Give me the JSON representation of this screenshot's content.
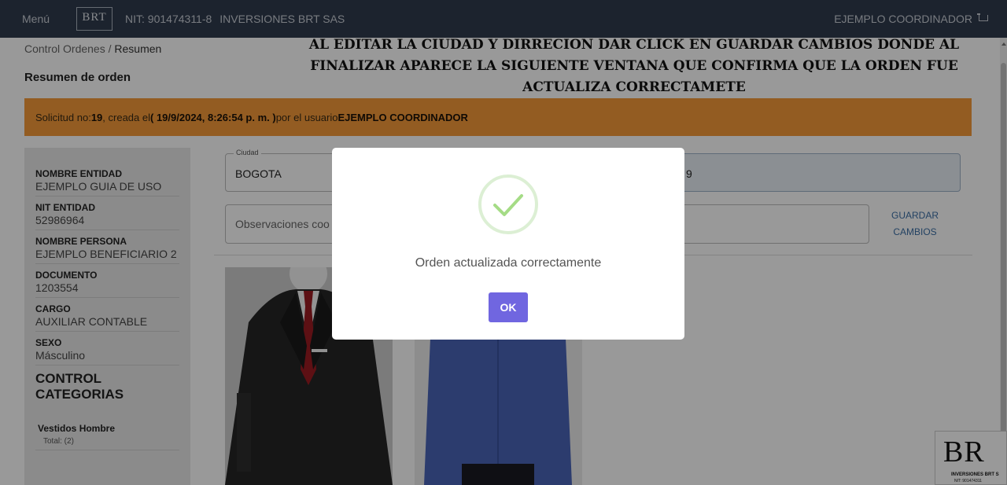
{
  "topbar": {
    "menu_label": "Menú",
    "logo_text": "BRT",
    "nit": "NIT: 901474311-8",
    "company": "INVERSIONES BRT SAS",
    "user": "EJEMPLO COORDINADOR"
  },
  "breadcrumb": {
    "parent": "Control Ordenes",
    "separator": "/",
    "current": "Resumen"
  },
  "page_title": "Resumen de orden",
  "annotation": "AL EDITAR LA CIUDAD Y DIRRECION DAR CLICK EN GUARDAR CAMBIOS DONDE AL FINALIZAR APARECE LA SIGUIENTE VENTANA QUE CONFIRMA QUE LA ORDEN FUE ACTUALIZA CORRECTAMETE",
  "banner": {
    "prefix": "Solicitud no: ",
    "number": "19",
    "mid": ", creada el ",
    "date": "( 19/9/2024, 8:26:54 p. m. )",
    "by": " por el usuario ",
    "user": "EJEMPLO COORDINADOR",
    "color": "#f59a3a"
  },
  "sidebar": {
    "fields": [
      {
        "label": "NOMBRE ENTIDAD",
        "value": "EJEMPLO GUIA DE USO"
      },
      {
        "label": "NIT ENTIDAD",
        "value": "52986964"
      },
      {
        "label": "NOMBRE PERSONA",
        "value": "EJEMPLO BENEFICIARIO 2"
      },
      {
        "label": "DOCUMENTO",
        "value": "1203554"
      },
      {
        "label": "CARGO",
        "value": "AUXILIAR CONTABLE"
      },
      {
        "label": "SEXO",
        "value": "Másculino"
      }
    ],
    "categories_title": "CONTROL CATEGORIAS",
    "categories": [
      {
        "name": "Vestidos Hombre",
        "total": "Total: (2)"
      }
    ]
  },
  "form": {
    "city_legend": "Ciudad",
    "city_value": "BOGOTA",
    "address_visible_value": "9",
    "observations_placeholder": "Observaciones coo",
    "save_line1": "GUARDAR",
    "save_line2": "CAMBIOS"
  },
  "modal": {
    "message": "Orden actualizada correctamente",
    "ok_label": "OK",
    "ok_color": "#7066e0",
    "icon": "success-check-icon"
  },
  "corner_logo": {
    "text": "BR",
    "subtitle": "INVERSIONES BRT S",
    "subtitle2": "NIT: 901474311"
  }
}
